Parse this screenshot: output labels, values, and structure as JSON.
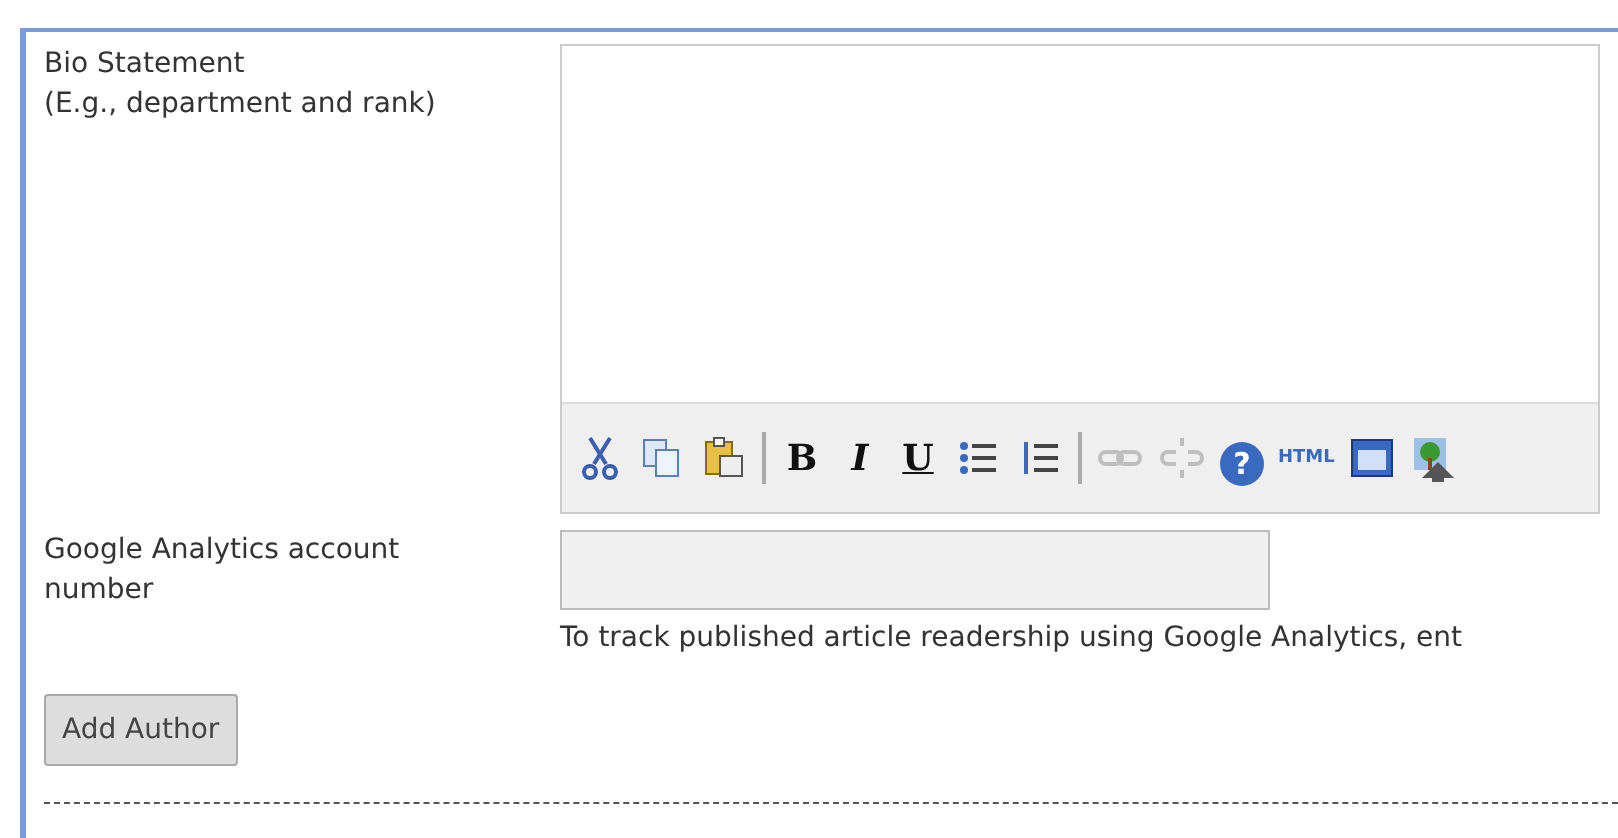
{
  "bio": {
    "label": "Bio Statement\n(E.g., department and rank)",
    "toolbar": [
      {
        "kind": "cut",
        "disabled": false
      },
      {
        "kind": "copy",
        "disabled": false
      },
      {
        "kind": "paste",
        "disabled": false
      },
      {
        "kind": "separator"
      },
      {
        "kind": "bold",
        "label": "B",
        "disabled": false
      },
      {
        "kind": "italic",
        "label": "I",
        "disabled": false
      },
      {
        "kind": "underline",
        "label": "U",
        "disabled": false
      },
      {
        "kind": "bullets",
        "disabled": false
      },
      {
        "kind": "numbers",
        "disabled": false
      },
      {
        "kind": "separator"
      },
      {
        "kind": "link",
        "disabled": true
      },
      {
        "kind": "unlink",
        "disabled": true
      },
      {
        "kind": "help",
        "label": "?",
        "disabled": false
      },
      {
        "kind": "html",
        "label": "HTML",
        "disabled": false
      },
      {
        "kind": "fullscreen",
        "disabled": false
      },
      {
        "kind": "image",
        "disabled": false
      }
    ]
  },
  "analytics": {
    "label": "Google Analytics account number",
    "help": "To track published article readership using Google Analytics, ent"
  },
  "button": "Add Author"
}
